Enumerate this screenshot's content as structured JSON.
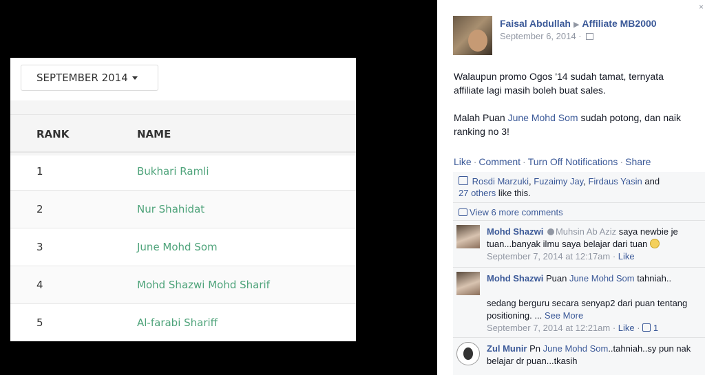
{
  "leaderboard": {
    "month_label": "SEPTEMBER 2014",
    "col_rank": "RANK",
    "col_name": "NAME",
    "rows": [
      {
        "rank": "1",
        "name": "Bukhari Ramli"
      },
      {
        "rank": "2",
        "name": "Nur Shahidat"
      },
      {
        "rank": "3",
        "name": "June Mohd Som"
      },
      {
        "rank": "4",
        "name": "Mohd Shazwi Mohd Sharif"
      },
      {
        "rank": "5",
        "name": "Al-farabi Shariff"
      }
    ]
  },
  "post": {
    "close": "×",
    "author": "Faisal Abdullah",
    "target": "Affiliate MB2000",
    "date": "September 6, 2014",
    "para1": "Walaupun promo Ogos '14 sudah tamat, ternyata affiliate lagi masih boleh buat sales.",
    "para2_pre": "Malah Puan ",
    "para2_link": "June Mohd Som",
    "para2_post": " sudah potong, dan naik ranking no 3!",
    "actions": [
      "Like",
      "Comment",
      "Turn Off Notifications",
      "Share"
    ],
    "likes_names": [
      "Rosdi Marzuki",
      "Fuzaimy Jay",
      "Firdaus Yasin"
    ],
    "likes_and": "and",
    "likes_others": "27 others",
    "likes_tail": "like this.",
    "more_comments": "View 6 more comments"
  },
  "comments": [
    {
      "author": "Mohd Shazwi",
      "tag": "Muhsin Ab Aziz",
      "text": "saya newbie je tuan...banyak ilmu saya belajar dari tuan",
      "time": "September 7, 2014 at 12:17am",
      "like": "Like"
    },
    {
      "author": "Mohd Shazwi",
      "text_pre": "Puan ",
      "text_link": "June Mohd Som",
      "text_post": " tahniah..",
      "text2": "sedang berguru secara senyap2 dari puan tentang positioning. ...",
      "see_more": "See More",
      "time": "September 7, 2014 at 12:21am",
      "like": "Like",
      "like_count": "1"
    },
    {
      "author": "Zul Munir",
      "text_pre": "Pn ",
      "text_link": "June Mohd Som",
      "text_post": "..tahniah..sy pun nak belajar dr puan...tkasih"
    }
  ]
}
